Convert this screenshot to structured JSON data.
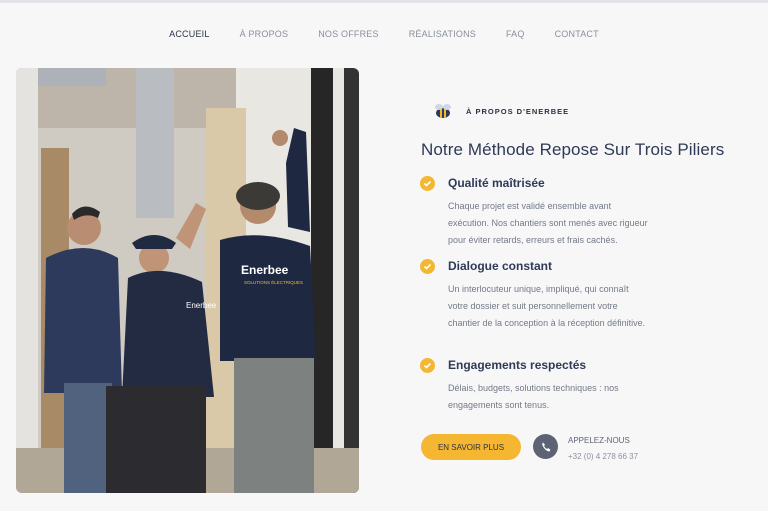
{
  "nav": {
    "items": [
      "ACCUEIL",
      "À PROPOS",
      "NOS OFFRES",
      "RÉALISATIONS",
      "FAQ",
      "CONTACT"
    ]
  },
  "photo": {
    "jacket_logo": "Enerbee",
    "jacket_sub": "SOLUTIONS ÉLECTRIQUES",
    "jacket_logo_small": "Enerbee"
  },
  "about": {
    "eyebrow": "À PROPOS D'ENERBEE",
    "title": "Notre Méthode Repose Sur Trois Piliers",
    "features": [
      {
        "title": "Qualité maîtrisée",
        "lines": [
          "Chaque projet est validé ensemble avant",
          "exécution. Nos chantiers sont menés avec rigueur",
          "pour éviter retards, erreurs et frais cachés."
        ]
      },
      {
        "title": "Dialogue constant",
        "lines": [
          "Un interlocuteur unique, impliqué, qui connaît",
          "votre dossier et suit personnellement votre",
          "chantier de la conception à la réception définitive."
        ]
      },
      {
        "title": "Engagements respectés",
        "lines": [
          "Délais, budgets, solutions techniques : nos",
          "engagements sont tenus."
        ]
      }
    ]
  },
  "cta": {
    "label": "EN SAVOIR PLUS"
  },
  "contact": {
    "label": "APPELEZ-NOUS",
    "phone": "+32 (0) 4 278 66 37"
  },
  "colors": {
    "accent": "#f5b731",
    "heading": "#2f3a56",
    "text": "#737a87",
    "background": "#f7f7f8"
  },
  "icons": {
    "brand": "bee-logo-icon",
    "check": "check-circle-icon",
    "phone": "phone-icon"
  }
}
